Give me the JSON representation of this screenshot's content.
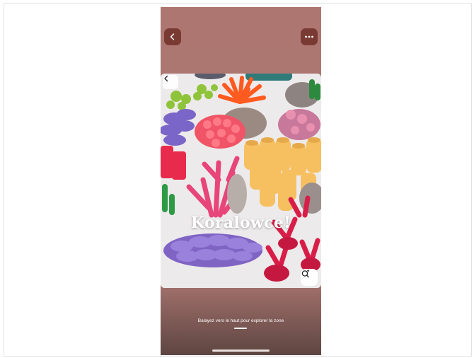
{
  "screen": {
    "photo_title": "Koralowce!",
    "hint_text": "Balayez vers le haut pour explorer la zone"
  },
  "icons": {
    "back": "chevron-left-icon",
    "more": "more-horizontal-icon",
    "photo_back": "chevron-left-icon",
    "lens": "visual-search-icon"
  },
  "colors": {
    "screen_background": "#ad7671",
    "button_background": "#7a3a34",
    "title_text": "#ffffff"
  }
}
